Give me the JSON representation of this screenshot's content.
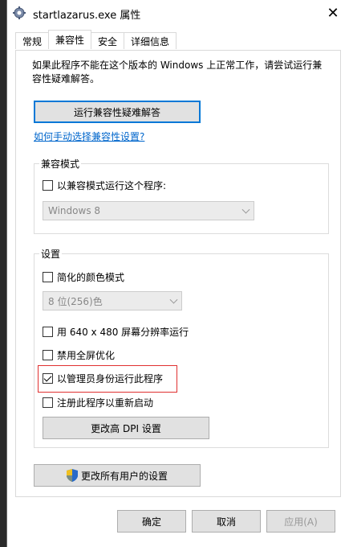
{
  "window": {
    "title": "startlazarus.exe 属性",
    "close_label": "✕"
  },
  "tabs": [
    "常规",
    "兼容性",
    "安全",
    "详细信息"
  ],
  "description": "如果此程序不能在这个版本的 Windows 上正常工作，请尝试运行兼容性疑难解答。",
  "troubleshooter_button": "运行兼容性疑难解答",
  "manual_link": "如何手动选择兼容性设置?",
  "compat_mode": {
    "title": "兼容模式",
    "checkbox_label": "以兼容模式运行这个程序:",
    "checked": false,
    "os_select": "Windows 8"
  },
  "settings": {
    "title": "设置",
    "reduced_color": {
      "label": "简化的颜色模式",
      "checked": false
    },
    "color_select": "8 位(256)色",
    "res_640": {
      "label": "用 640 x 480 屏幕分辨率运行",
      "checked": false
    },
    "disable_fullscreen": {
      "label": "禁用全屏优化",
      "checked": false
    },
    "run_as_admin": {
      "label": "以管理员身份运行此程序",
      "checked": true
    },
    "register_restart": {
      "label": "注册此程序以重新启动",
      "checked": false
    },
    "dpi_button": "更改高 DPI 设置"
  },
  "all_users_button": "更改所有用户的设置",
  "footer": {
    "ok": "确定",
    "cancel": "取消",
    "apply": "应用(A)"
  },
  "colors": {
    "accent": "#0078d7",
    "highlight": "#e03030",
    "link": "#0066cc"
  }
}
